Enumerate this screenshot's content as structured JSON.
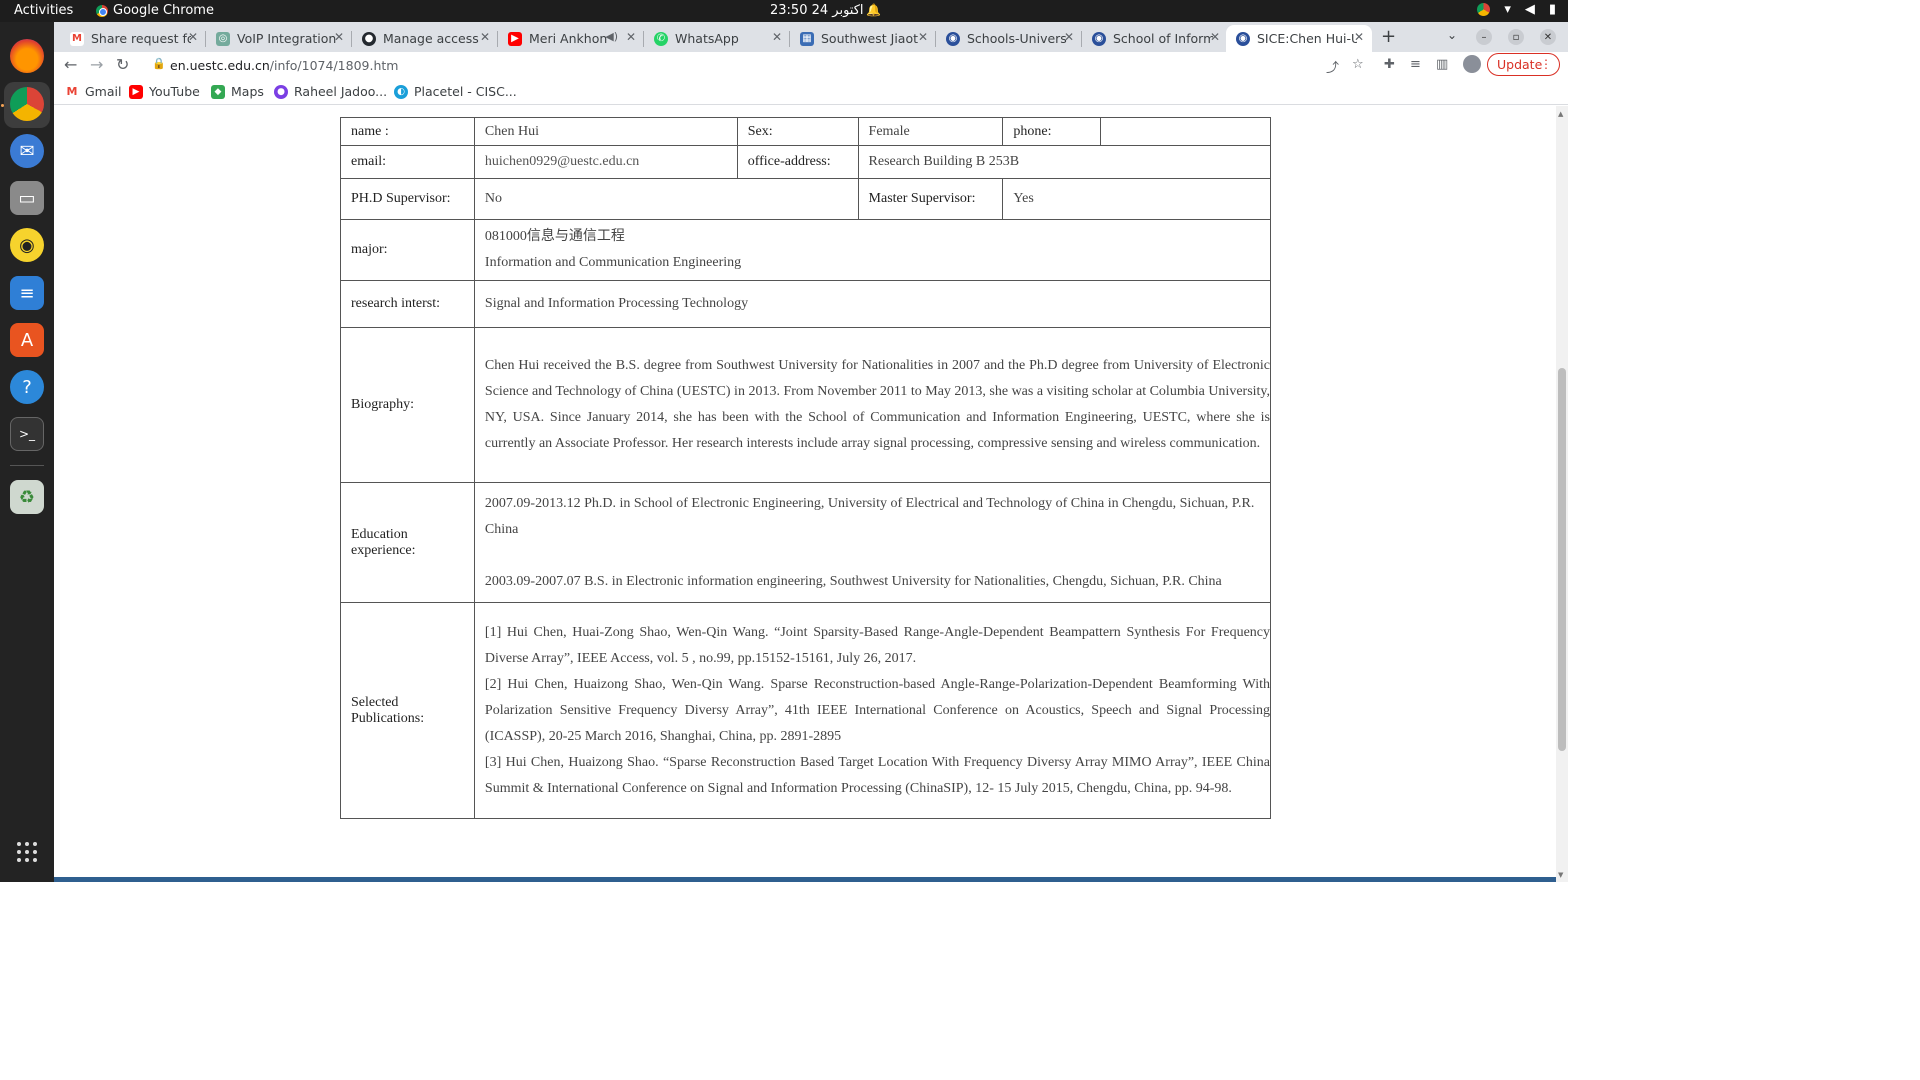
{
  "system": {
    "activities": "Activities",
    "app_name": "Google Chrome",
    "clock": "23:50  24 اکتوبر"
  },
  "tabs": [
    {
      "title": "Share request fo",
      "fav_color": "#ffffff",
      "fav_glyph": "M"
    },
    {
      "title": "VoIP Integration",
      "fav_color": "#74aa9c",
      "fav_glyph": "◎"
    },
    {
      "title": "Manage access",
      "fav_color": "#24292f",
      "fav_glyph": "●"
    },
    {
      "title": "Meri Ankhon",
      "fav_color": "#ff0000",
      "fav_glyph": "▶"
    },
    {
      "title": "WhatsApp",
      "fav_color": "#25d366",
      "fav_glyph": "✆"
    },
    {
      "title": "Southwest Jiaot",
      "fav_color": "#3b6db5",
      "fav_glyph": "▦"
    },
    {
      "title": "Schools-Universi",
      "fav_color": "#2a4f9a",
      "fav_glyph": "◉"
    },
    {
      "title": "School of Inform",
      "fav_color": "#2a4f9a",
      "fav_glyph": "◉"
    },
    {
      "title": "SICE:Chen Hui-U",
      "fav_color": "#2a4f9a",
      "fav_glyph": "◉"
    }
  ],
  "toolbar": {
    "url_host": "en.uestc.edu.cn",
    "url_path": "/info/1074/1809.htm",
    "update_label": "Update"
  },
  "bookmarks": [
    {
      "label": "Gmail",
      "color": "#ffffff",
      "glyph": "M"
    },
    {
      "label": "YouTube",
      "color": "#ff0000",
      "glyph": "▶"
    },
    {
      "label": "Maps",
      "color": "#34a853",
      "glyph": "◆"
    },
    {
      "label": "Raheel Jadoo...",
      "color": "#7b3fe4",
      "glyph": "●"
    },
    {
      "label": "Placetel - CISC...",
      "color": "#1a9fd9",
      "glyph": "◐"
    }
  ],
  "profile": {
    "name_label": "name :",
    "name_value": "Chen Hui",
    "sex_label": "Sex:",
    "sex_value": "Female",
    "phone_label": "phone:",
    "phone_value": "",
    "email_label": "email:",
    "email_value": "huichen0929@uestc.edu.cn",
    "office_label": "office-address:",
    "office_value": "Research Building B 253B",
    "phd_label": "PH.D  Supervisor:",
    "phd_value": "No",
    "master_label": "Master Supervisor:",
    "master_value": "Yes",
    "major_label": "major:",
    "major_code": "081000信息与通信工程",
    "major_en": "Information and Communication Engineering",
    "research_label": "research interst:",
    "research_value": "Signal and Information Processing Technology",
    "bio_label": "Biography:",
    "bio_text": "Chen Hui received the B.S. degree from Southwest University for Nationalities in 2007 and the Ph.D degree from University of Electronic Science and Technology of China (UESTC) in 2013. From November 2011 to May 2013, she was a visiting scholar at Columbia University, NY, USA. Since January 2014, she has been with the School of Communication and Information Engineering, UESTC, where she is currently an Associate Professor. Her research interests include array signal processing, compressive sensing and wireless communication.",
    "edu_label": "Education experience:",
    "edu_items": [
      "2007.09-2013.12 Ph.D. in School of Electronic Engineering, University of Electrical and Technology of China in Chengdu, Sichuan, P.R. China",
      "2003.09-2007.07 B.S. in Electronic information engineering, Southwest University for Nationalities, Chengdu, Sichuan, P.R. China"
    ],
    "pub_label": "Selected Publications:",
    "pub_items": [
      "[1] Hui Chen, Huai-Zong Shao, Wen-Qin Wang. “Joint Sparsity-Based Range-Angle-Dependent Beampattern Synthesis For Frequency Diverse Array”, IEEE Access, vol. 5 , no.99, pp.15152-15161, July 26,  2017.",
      "[2] Hui Chen, Huaizong Shao, Wen-Qin Wang. Sparse Reconstruction-based Angle-Range-Polarization-Dependent Beamforming With Polarization Sensitive Frequency Diversy Array”, 41th IEEE International Conference on Acoustics, Speech and Signal Processing (ICASSP), 20-25 March 2016, Shanghai, China, pp. 2891-2895",
      "[3] Hui Chen, Huaizong Shao. “Sparse Reconstruction Based Target Location With Frequency Diversy Array MIMO Array”, IEEE China Summit & International Conference on Signal and Information Processing (ChinaSIP), 12- 15 July 2015, Chengdu, China, pp. 94-98."
    ]
  }
}
